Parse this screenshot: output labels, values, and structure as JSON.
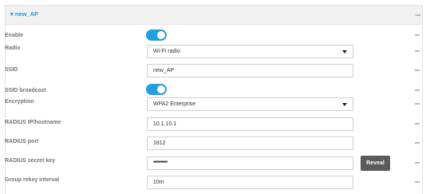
{
  "header": {
    "title": "▾ new_AP"
  },
  "rows": {
    "enable": {
      "label": "Enable"
    },
    "radio": {
      "label": "Radio",
      "value": "Wi-Fi radio"
    },
    "ssid": {
      "label": "SSID",
      "value": "new_AP"
    },
    "ssid_broadcast": {
      "label": "SSID broadcast"
    },
    "encryption": {
      "label": "Encryption",
      "value": "WPA2 Enterprise"
    },
    "radius_ip": {
      "label": "RADIUS IP/hostname",
      "value": "10.1.10.1"
    },
    "radius_port": {
      "label": "RADIUS port",
      "value": "1812"
    },
    "radius_secret": {
      "label": "RADIUS secret key",
      "value": "••••••••••••"
    },
    "group_rekey": {
      "label": "Group rekey interval",
      "value": "10m"
    }
  },
  "buttons": {
    "reveal": "Reveal"
  },
  "colors": {
    "accent": "#1a9edb",
    "toggle_on": "#1ea0e2",
    "button_dark": "#5b5b5b"
  }
}
